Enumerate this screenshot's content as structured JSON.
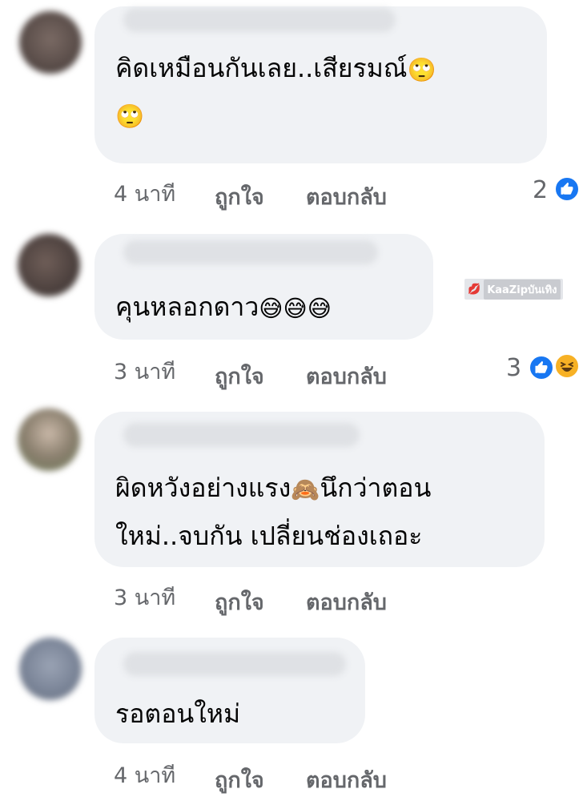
{
  "comments": [
    {
      "text_lines": [
        "คิดเหมือนกันเลย..เสียรมณ์",
        ""
      ],
      "emoji_after_line0": "🙄",
      "emoji_line1": "🙄",
      "time": "4 นาที",
      "like_label": "ถูกใจ",
      "reply_label": "ตอบกลับ",
      "reaction_count": "2",
      "reactions": [
        "like"
      ]
    },
    {
      "text_lines": [
        "คุนหลอกดาว"
      ],
      "emojis": "😅😅😅",
      "time": "3 นาที",
      "like_label": "ถูกใจ",
      "reply_label": "ตอบกลับ",
      "reaction_count": "3",
      "reactions": [
        "like",
        "haha"
      ]
    },
    {
      "text_line0_a": "ผิดหวังอย่างแรง",
      "emoji": "🙈",
      "text_line0_b": "นึกว่าตอน",
      "text_line1": "ใหม่..จบกัน เปลี่ยนช่องเถอะ",
      "time": "3 นาที",
      "like_label": "ถูกใจ",
      "reply_label": "ตอบกลับ"
    },
    {
      "text_lines": [
        "รอตอนใหม่"
      ],
      "time": "4 นาที",
      "like_label": "ถูกใจ",
      "reply_label": "ตอบกลับ"
    }
  ],
  "watermark": {
    "icon": "lips-icon",
    "text": "KaaZipบันเทิง"
  },
  "colors": {
    "bubble": "#f0f2f5",
    "meta_text": "#65676b",
    "like_blue": "#1877f2",
    "haha_yellow": "#f7b125"
  }
}
